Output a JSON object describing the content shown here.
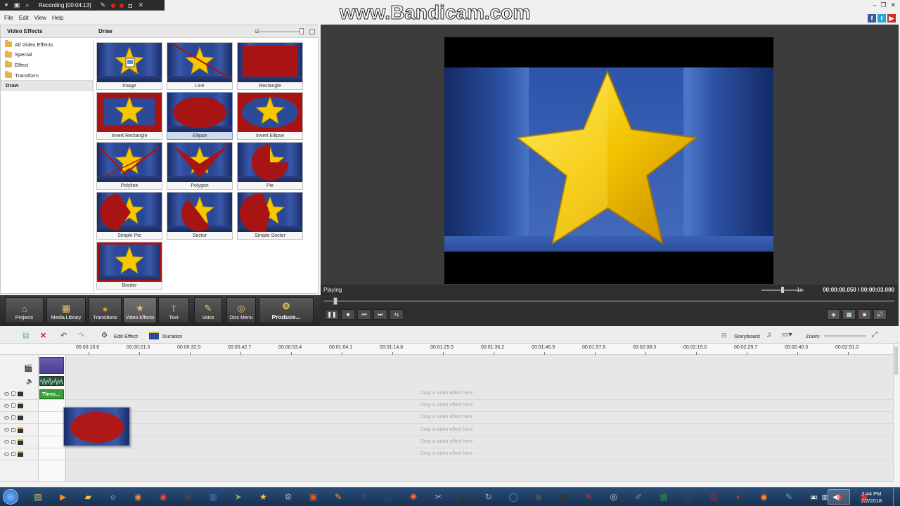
{
  "recorder": {
    "title": "Recording [00:04:13]"
  },
  "watermark": "www.Bandicam.com",
  "menu": [
    "File",
    "Edit",
    "View",
    "Help"
  ],
  "effects_panel": {
    "categories_header": "Video Effects",
    "categories": [
      {
        "label": "All Video Effects",
        "selected": false
      },
      {
        "label": "Special",
        "selected": false
      },
      {
        "label": "Effect",
        "selected": false
      },
      {
        "label": "Transform",
        "selected": false
      },
      {
        "label": "Draw",
        "selected": true
      }
    ],
    "grid_header": "Draw",
    "effects": [
      {
        "label": "Image",
        "overlay": "image",
        "selected": false
      },
      {
        "label": "Line",
        "overlay": "line",
        "selected": false
      },
      {
        "label": "Rectangle",
        "overlay": "rectangle",
        "selected": false
      },
      {
        "label": "Invert Rectangle",
        "overlay": "invert-rectangle",
        "selected": false
      },
      {
        "label": "Ellipse",
        "overlay": "ellipse",
        "selected": true
      },
      {
        "label": "Invert Ellipse",
        "overlay": "invert-ellipse",
        "selected": false
      },
      {
        "label": "Polyline",
        "overlay": "polyline",
        "selected": false
      },
      {
        "label": "Polygon",
        "overlay": "polygon",
        "selected": false
      },
      {
        "label": "Pie",
        "overlay": "pie",
        "selected": false
      },
      {
        "label": "Simple Pie",
        "overlay": "simple-pie",
        "selected": false
      },
      {
        "label": "Sector",
        "overlay": "sector",
        "selected": false
      },
      {
        "label": "Simple Sector",
        "overlay": "simple-sector",
        "selected": false
      },
      {
        "label": "Border",
        "overlay": "border",
        "selected": false
      }
    ]
  },
  "player": {
    "status": "Playing",
    "speed": "1x",
    "timecode": "00:00:00.050 / 00:00:03.000",
    "position_fraction": 0.017
  },
  "toolbar": {
    "buttons": [
      {
        "label": "Projects",
        "icon": "projects-icon",
        "active": false
      },
      {
        "label": "Media Library",
        "icon": "media-library-icon",
        "active": false
      },
      {
        "label": "Transitions",
        "icon": "transitions-icon",
        "active": false
      },
      {
        "label": "Video Effects",
        "icon": "video-effects-icon",
        "active": true
      },
      {
        "label": "Text",
        "icon": "text-icon",
        "active": false
      },
      {
        "label": "Voice",
        "icon": "microphone-icon",
        "active": false
      },
      {
        "label": "Disc Menu",
        "icon": "disc-menu-icon",
        "active": false
      },
      {
        "label": "Produce...",
        "icon": "produce-icon",
        "active": false
      }
    ]
  },
  "timeline": {
    "edit_effect_label": "Edit Effect",
    "duration_label": "Duration",
    "storyboard_label": "Storyboard",
    "zoom_label": "Zoom:",
    "ruler": [
      "00:00:10.6",
      "00:00:21.3",
      "00:00:32.0",
      "00:00:42.7",
      "00:00:53.4",
      "00:01:04.1",
      "00:01:14.8",
      "00:01:25.5",
      "00:01:36.2",
      "00:01:46.9",
      "00:01:57.6",
      "00:02:08.3",
      "00:02:19.0",
      "00:02:29.7",
      "00:02:40.3",
      "00:02:51.0"
    ],
    "effect_clip_label": "Thres...",
    "drop_text": "Drop a video effect here",
    "effect_rows": 6
  },
  "taskbar": {
    "apps": [
      "explorer-icon",
      "media-player-icon",
      "folder-icon",
      "internet-explorer-icon",
      "firefox-icon",
      "chrome-icon",
      "app-icon",
      "video-editor-icon",
      "cursor-app-icon",
      "star-app-icon",
      "gear-app-icon",
      "office-app-icon",
      "paint-app-icon",
      "yahoo-icon",
      "headphones-icon",
      "flame-app-icon",
      "tools-icon",
      "notepad-icon",
      "refresh-app-icon",
      "globe-icon",
      "camera-app-icon",
      "terminal-icon",
      "pen-app-icon",
      "disc-app-icon",
      "sketch-app-icon",
      "recorder-app-icon",
      "film-app-icon",
      "archive-app-icon",
      "media-app-icon",
      "firefox-icon-2",
      "edit-app-icon",
      "window-app-icon",
      "chrome-icon-2",
      "pdf-app-icon"
    ],
    "time": "2:44 PM",
    "date": "2/2/2018"
  }
}
